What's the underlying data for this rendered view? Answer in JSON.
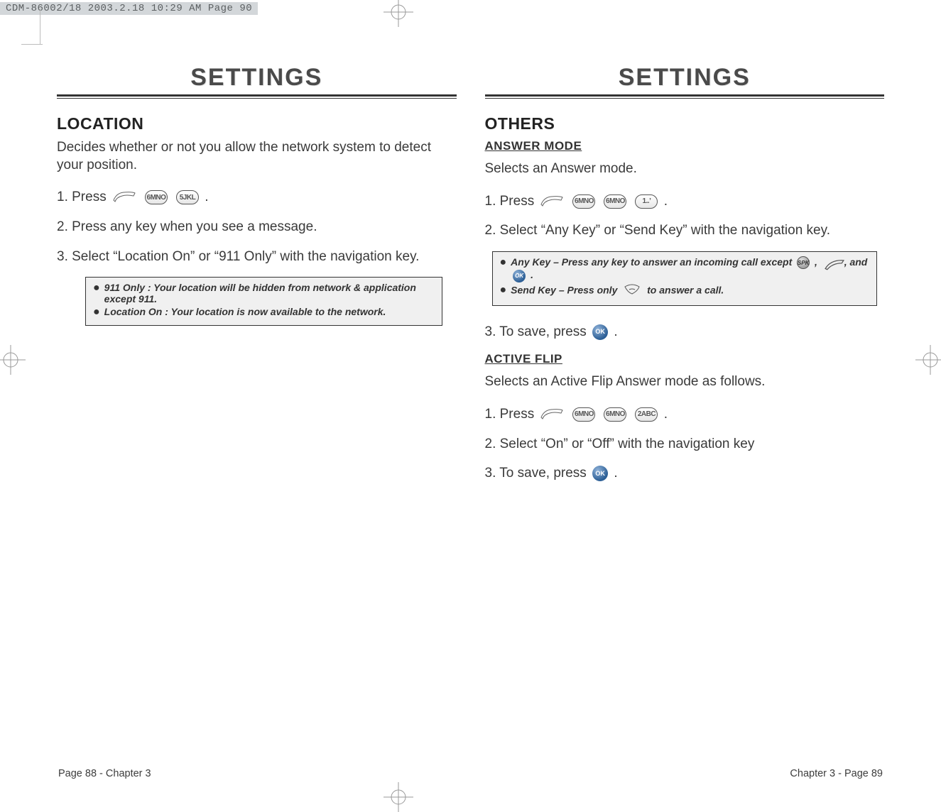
{
  "header_strip": "CDM-86002/18  2003.2.18  10:29 AM  Page 90",
  "left": {
    "title": "SETTINGS",
    "section": "LOCATION",
    "intro": "Decides whether or not you allow the network system to detect your position.",
    "step1_a": "1. Press ",
    "step1_b": " .",
    "step2": "2. Press any key when you see a message.",
    "step3": "3. Select “Location On” or “911 Only” with the navigation key.",
    "note1": "911 Only : Your location will be hidden from network & application except 911.",
    "note2": "Location On : Your location is now available to the network.",
    "footer": "Page 88 - Chapter 3"
  },
  "right": {
    "title": "SETTINGS",
    "section": "OTHERS",
    "sub1": "ANSWER MODE",
    "intro1": "Selects an Answer mode.",
    "s1_step1_a": "1. Press ",
    "s1_step1_b": " .",
    "s1_step2": "2.  Select “Any Key” or “Send Key” with the navigation key.",
    "note1a": "Any Key – Press any key to answer an incoming call except  ",
    "note1b": "  ,  ",
    "note1c": " , and  ",
    "note1d": " .",
    "note2a": "Send Key – Press only  ",
    "note2b": "   to answer a call.",
    "s1_step3_a": "3. To save, press  ",
    "s1_step3_b": "  .",
    "sub2": "ACTIVE FLIP",
    "intro2": "Selects an Active Flip Answer mode as follows.",
    "s2_step1_a": "1. Press ",
    "s2_step1_b": " .",
    "s2_step2": "2. Select “On” or “Off” with the navigation key",
    "s2_step3_a": "3. To save, press  ",
    "s2_step3_b": "  .",
    "footer": "Chapter 3 - Page 89"
  },
  "icons": {
    "menu": "MENU",
    "six": "6MNO",
    "five": "5JKL",
    "one": "1..’",
    "two": "2ABC",
    "ok": "OK",
    "spk": "SPK"
  }
}
